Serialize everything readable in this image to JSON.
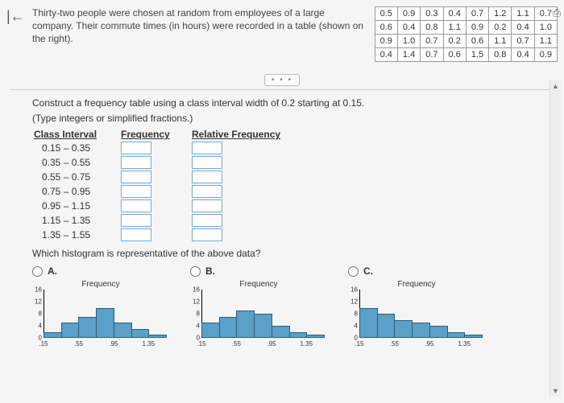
{
  "nav": {
    "back": "|←"
  },
  "problem": "Thirty-two people were chosen at random from employees of a large company. Their commute times (in hours) were recorded in a table (shown on the right).",
  "data_table": [
    [
      "0.5",
      "0.9",
      "0.3",
      "0.4",
      "0.7",
      "1.2",
      "1.1",
      "0.7"
    ],
    [
      "0.6",
      "0.4",
      "0.8",
      "1.1",
      "0.9",
      "0.2",
      "0.4",
      "1.0"
    ],
    [
      "0.9",
      "1.0",
      "0.7",
      "0.2",
      "0.6",
      "1.1",
      "0.7",
      "1.1"
    ],
    [
      "0.4",
      "1.4",
      "0.7",
      "0.6",
      "1.5",
      "0.8",
      "0.4",
      "0.9"
    ]
  ],
  "pager": "• • •",
  "instruction": "Construct a frequency table using a class interval width of 0.2 starting at 0.15.",
  "subinstruction": "(Type integers or simplified fractions.)",
  "freq": {
    "headers": {
      "c1": "Class Interval",
      "c2": "Frequency",
      "c3": "Relative Frequency"
    },
    "rows": [
      "0.15 – 0.35",
      "0.35 – 0.55",
      "0.55 – 0.75",
      "0.75 – 0.95",
      "0.95 – 1.15",
      "1.15 – 1.35",
      "1.35 – 1.55"
    ]
  },
  "hist_question": "Which histogram is representative of the above data?",
  "options": {
    "A": {
      "label": "A."
    },
    "B": {
      "label": "B."
    },
    "C": {
      "label": "C."
    }
  },
  "chart_data": [
    {
      "type": "bar",
      "title": "Frequency",
      "categories": [
        ".15",
        ".35",
        ".55",
        ".75",
        ".95",
        "1.15",
        "1.35"
      ],
      "values": [
        2,
        5,
        7,
        10,
        5,
        3,
        1
      ],
      "ylim": [
        0,
        16
      ],
      "yticks": [
        16,
        12,
        8,
        4,
        0
      ],
      "xticks": [
        ".15",
        ".55",
        ".95",
        "1.35"
      ]
    },
    {
      "type": "bar",
      "title": "Frequency",
      "categories": [
        ".15",
        ".35",
        ".55",
        ".75",
        ".95",
        "1.15",
        "1.35"
      ],
      "values": [
        5,
        7,
        9,
        8,
        4,
        2,
        1
      ],
      "ylim": [
        0,
        16
      ],
      "yticks": [
        16,
        12,
        8,
        4,
        0
      ],
      "xticks": [
        ".15",
        ".55",
        ".95",
        "1.35"
      ]
    },
    {
      "type": "bar",
      "title": "Frequency",
      "categories": [
        ".15",
        ".35",
        ".55",
        ".75",
        ".95",
        "1.15",
        "1.35"
      ],
      "values": [
        10,
        8,
        6,
        5,
        4,
        2,
        1
      ],
      "ylim": [
        0,
        16
      ],
      "yticks": [
        16,
        12,
        8,
        4,
        0
      ],
      "xticks": [
        ".15",
        ".55",
        ".95",
        "1.35"
      ]
    }
  ],
  "icons": {
    "print": "⎙"
  }
}
